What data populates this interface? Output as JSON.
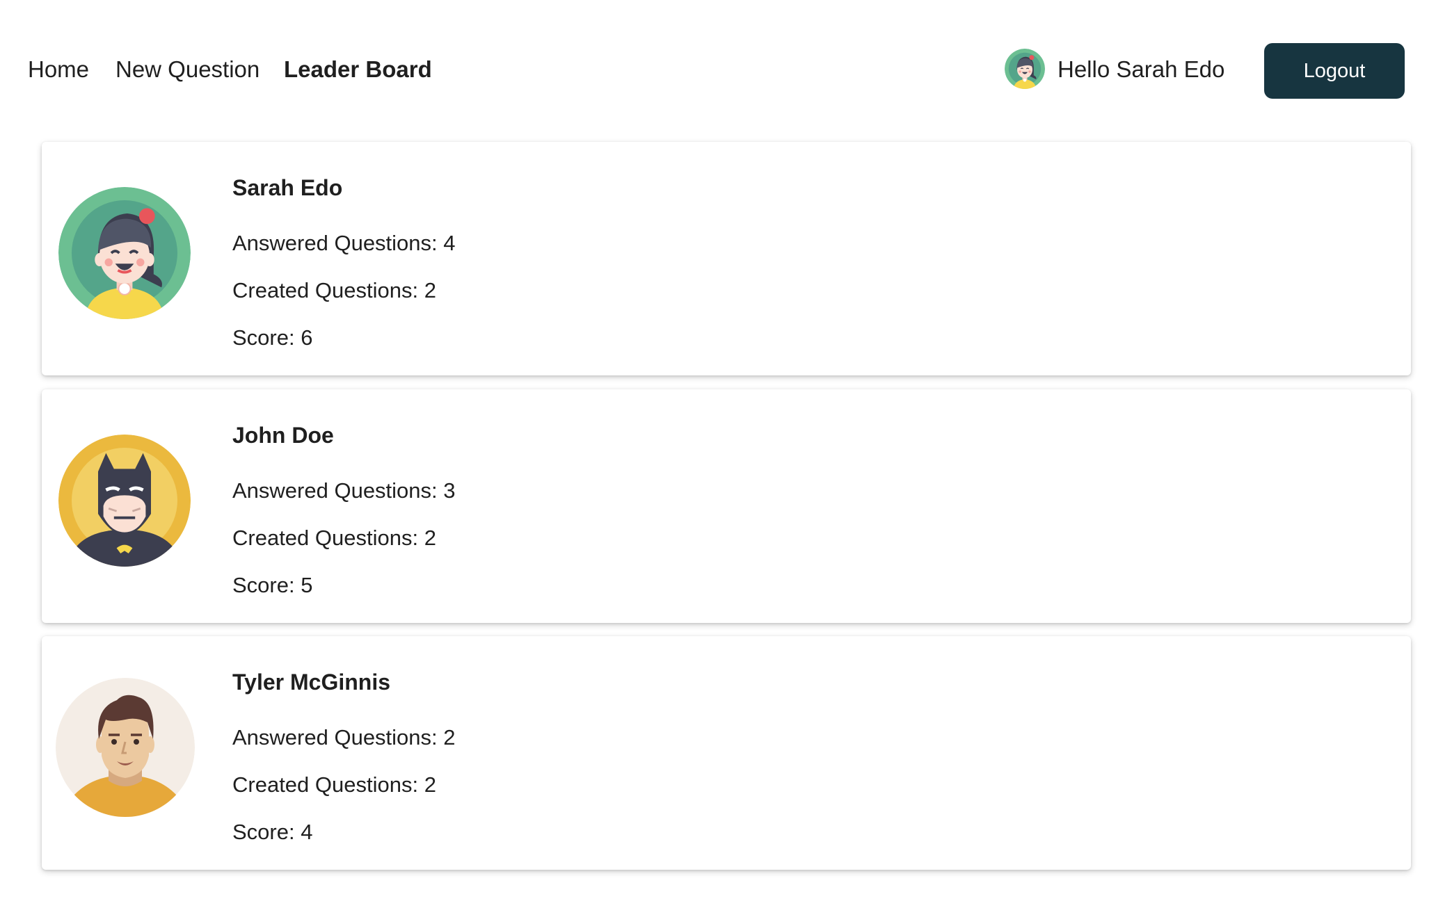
{
  "nav": {
    "home_label": "Home",
    "new_question_label": "New Question",
    "leader_board_label": "Leader Board",
    "active": "Leader Board"
  },
  "user": {
    "greeting": "Hello Sarah Edo",
    "avatar_icon": "girl-avatar-icon"
  },
  "logout_label": "Logout",
  "colors": {
    "logout_bg": "#173540",
    "text": "#1f1f1f"
  },
  "leaderboard": [
    {
      "name": "Sarah Edo",
      "answered": "Answered Questions: 4",
      "created": "Created Questions: 2",
      "score": "Score: 6",
      "avatar_icon": "girl-avatar-icon"
    },
    {
      "name": "John Doe",
      "answered": "Answered Questions: 3",
      "created": "Created Questions: 2",
      "score": "Score: 5",
      "avatar_icon": "batman-avatar-icon"
    },
    {
      "name": "Tyler McGinnis",
      "answered": "Answered Questions: 2",
      "created": "Created Questions: 2",
      "score": "Score: 4",
      "avatar_icon": "man-avatar-icon"
    }
  ]
}
